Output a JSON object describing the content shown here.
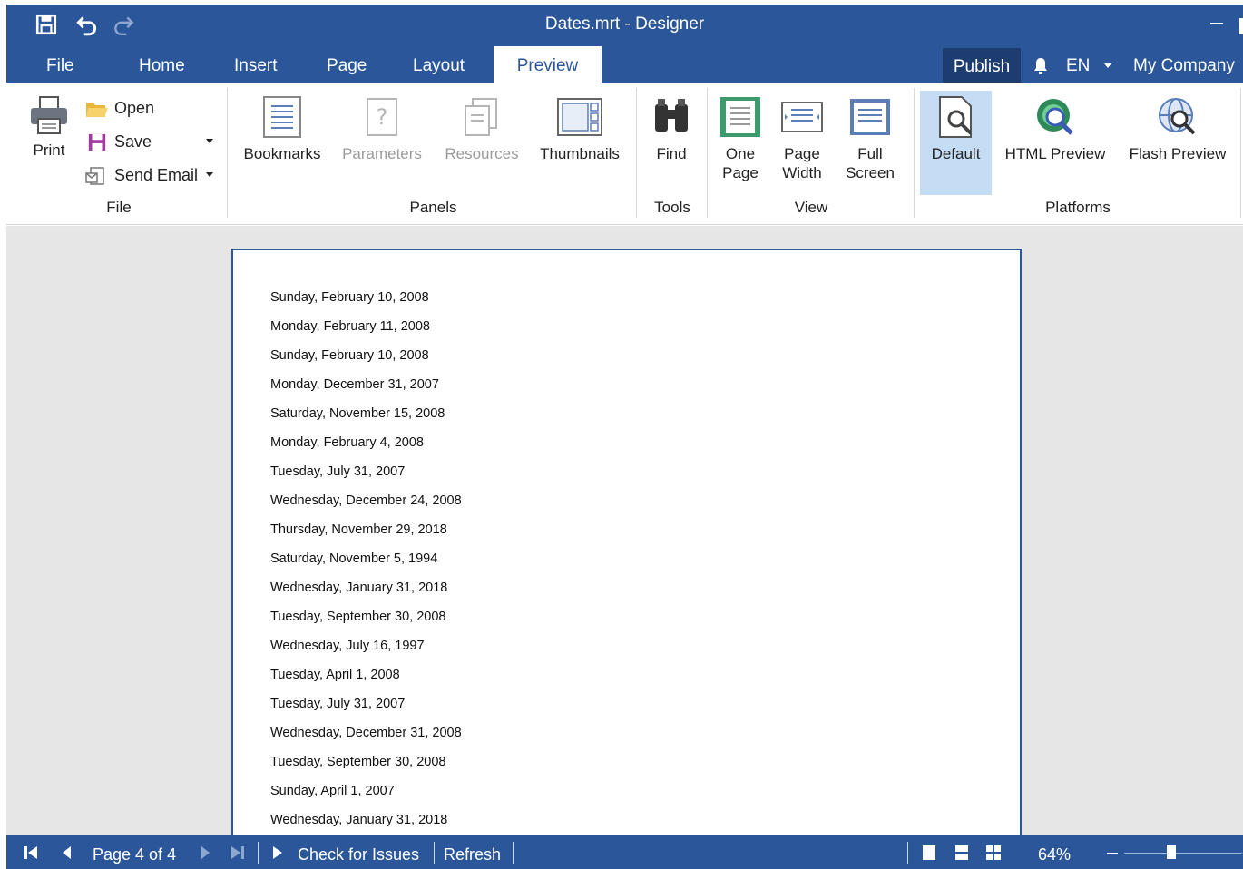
{
  "window": {
    "title": "Dates.mrt - Designer"
  },
  "menu": {
    "tabs": [
      {
        "label": "File"
      },
      {
        "label": "Home"
      },
      {
        "label": "Insert"
      },
      {
        "label": "Page"
      },
      {
        "label": "Layout"
      },
      {
        "label": "Preview"
      }
    ],
    "active_tab": "Preview",
    "publish_label": "Publish",
    "language": "EN",
    "company": "My Company"
  },
  "ribbon": {
    "file": {
      "group_label": "File",
      "print_label": "Print",
      "open_label": "Open",
      "save_label": "Save",
      "send_email_label": "Send Email"
    },
    "panels": {
      "group_label": "Panels",
      "bookmarks_label": "Bookmarks",
      "parameters_label": "Parameters",
      "resources_label": "Resources",
      "thumbnails_label": "Thumbnails"
    },
    "tools": {
      "group_label": "Tools",
      "find_label": "Find"
    },
    "view": {
      "group_label": "View",
      "one_page_line1": "One",
      "one_page_line2": "Page",
      "page_width_line1": "Page",
      "page_width_line2": "Width",
      "full_screen_line1": "Full",
      "full_screen_line2": "Screen"
    },
    "platforms": {
      "group_label": "Platforms",
      "default_label": "Default",
      "html_preview_label": "HTML Preview",
      "flash_preview_label": "Flash Preview"
    }
  },
  "report": {
    "dates": [
      "Sunday, February 10, 2008",
      "Monday, February 11, 2008",
      "Sunday, February 10, 2008",
      "Monday, December 31, 2007",
      "Saturday, November 15, 2008",
      "Monday, February 4, 2008",
      "Tuesday, July 31, 2007",
      "Wednesday, December 24, 2008",
      "Thursday, November 29, 2018",
      "Saturday, November 5, 1994",
      "Wednesday, January 31, 2018",
      "Tuesday, September 30, 2008",
      "Wednesday, July 16, 1997",
      "Tuesday, April 1, 2008",
      "Tuesday, July 31, 2007",
      "Wednesday, December 31, 2008",
      "Tuesday, September 30, 2008",
      "Sunday, April 1, 2007",
      "Wednesday, January 31, 2018"
    ]
  },
  "statusbar": {
    "page_info": "Page 4 of 4",
    "check_issues_label": "Check for Issues",
    "refresh_label": "Refresh",
    "zoom": "64%"
  },
  "colors": {
    "accent": "#2b579a",
    "publish_bg": "#1d3d71",
    "highlight": "#c5dcf5",
    "workspace": "#e6e6e6"
  }
}
